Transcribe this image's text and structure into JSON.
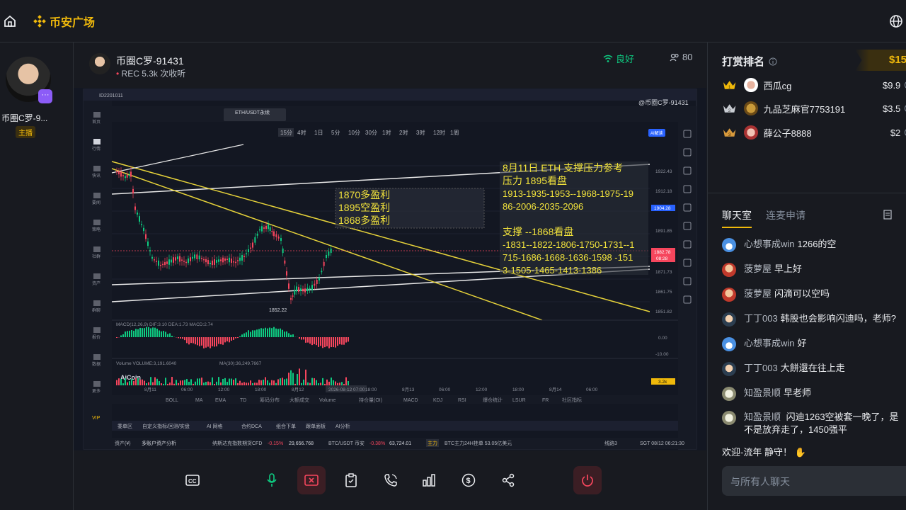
{
  "topbar": {
    "brand": "币安广场",
    "home_icon": "home-icon",
    "globe_icon": "globe-icon"
  },
  "host": {
    "name": "币圈C罗-9...",
    "role": "主播"
  },
  "stream": {
    "title": "币圈C罗-91431",
    "rec_label": "REC",
    "listeners": "5.3k 次收听",
    "signal": "良好",
    "viewers": "80"
  },
  "chart": {
    "top_info": "ID2201011",
    "account_label": "@币圈C罗-91431",
    "pair": "ETH/USDT永续",
    "timeframes": [
      "15分",
      "4时",
      "1日",
      "5分",
      "10分",
      "30分",
      "1时",
      "2时",
      "3时",
      "12时",
      "1周"
    ],
    "annotation_right": {
      "title": "8月11日  ETH 支撑压力参考",
      "resistance_head": "压力 1895看盘",
      "resistance_levels_1": "1913-1935-1953--1968-1975-19",
      "resistance_levels_2": "86-2006-2035-2096",
      "support_head": "支撑 --1868看盘",
      "support_levels_1": "-1831--1822-1806-1750-1731--1",
      "support_levels_2": "715-1686-1668-1636-1598 -151",
      "support_levels_3": "3-1505-1465-1413-1386"
    },
    "annotation_left": [
      "1870多盈利",
      "1895空盈利",
      "1868多盈利"
    ],
    "low_label": "1852.22",
    "price_ticks": [
      "1922.43",
      "1912.18",
      "1904.28",
      "1891.85",
      "1882.78",
      "1871.73",
      "1861.75",
      "1851.82"
    ],
    "macd_label": "MACD(12,26,9)  DIF:3.10  DEA:1.73  MACD:2.74",
    "macd_ticks": [
      "0.00",
      "-10.00"
    ],
    "volume_label": "Volume  VOLUME:3,191.6040",
    "ma_label": "MA(30):36,249.7667",
    "brand_watermark": "AiCoin",
    "time_labels": [
      "8月11",
      "06:00",
      "12:00",
      "18:00",
      "8月12",
      "2026-08-12 07:00",
      "18:00",
      "8月13",
      "06:00",
      "12:00",
      "18:00",
      "8月14",
      "06:00"
    ],
    "indicators": [
      "BOLL",
      "MA",
      "EMA",
      "TD",
      "筹码分布",
      "大额成交",
      "Volume",
      "持仓量(OI)",
      "MACD",
      "KDJ",
      "RSI",
      "爆仓统计",
      "LSUR",
      "FR",
      "社区指标"
    ],
    "bottom_tabs": [
      "委单区",
      "自定义指标/回测/实盘",
      "AI 网格",
      "合约DCA",
      "组合下单",
      "跟单面板",
      "AI分析"
    ],
    "status_left": "资产(¥)",
    "status_assets": "多账户资产分析",
    "status_nasdaq": "纳斯达克指数期货CFD",
    "status_nasdaq_chg": "-0.15%",
    "status_nasdaq_val": "29,656.768",
    "status_btc": "BTC/USDT 币安",
    "status_btc_chg": "-0.38%",
    "status_btc_val": "63,724.01",
    "status_flow_tag": "主力",
    "status_flow": "BTC主力24H挂单 53.05亿美元",
    "status_line": "线路3",
    "status_time": "SGT 08/12 06:21:30",
    "sidebar": [
      "首页",
      "行情",
      "快讯",
      "要闻",
      "策略",
      "社群",
      "资产",
      "群聊",
      "报价",
      "数据",
      "更多"
    ],
    "vip": "VIP",
    "price_red": "1882.78",
    "price_time": "08:28",
    "price_blue": "1904.28",
    "ai_btn": "AI解读",
    "vol_tick": "3.2k"
  },
  "controls": [
    "cc-icon",
    "mic-icon",
    "stop-share-icon",
    "clipboard-icon",
    "phone-icon",
    "chart-icon",
    "dollar-icon",
    "share-icon",
    "power-icon"
  ],
  "ranking": {
    "title": "打赏排名",
    "total": "$15",
    "rows": [
      {
        "rank": "1",
        "name": "西瓜cg",
        "amount": "$9.9"
      },
      {
        "rank": "2",
        "name": "九品芝麻官7753191",
        "amount": "$3.5"
      },
      {
        "rank": "3",
        "name": "薛公子8888",
        "amount": "$2"
      }
    ]
  },
  "chat": {
    "tabs": [
      "聊天室",
      "连麦申请"
    ],
    "messages": [
      {
        "user": "心想事成win",
        "text": "1266的空"
      },
      {
        "user": "菠萝屋",
        "text": "早上好"
      },
      {
        "user": "菠萝屋",
        "text": "闪滴可以空吗"
      },
      {
        "user": "丁丁003",
        "text": "韩股也会影响闪迪吗，老师?"
      },
      {
        "user": "心想事成win",
        "text": "好"
      },
      {
        "user": "丁丁003",
        "text": "大餅還在往上走"
      },
      {
        "user": "知盈景顺",
        "text": "早老师"
      },
      {
        "user": "知盈景顺",
        "text": "闪迪1263空被套一晚了，是不是放弃走了，1450强平"
      }
    ],
    "welcome_prefix": "欢迎-",
    "welcome_user": "流年",
    "welcome_suffix": "静守！",
    "input_placeholder": "与所有人聊天"
  },
  "colors": {
    "brand": "#f0b90b",
    "up": "#0ecb81",
    "down": "#f6465d",
    "annotation": "#f2e33c"
  }
}
